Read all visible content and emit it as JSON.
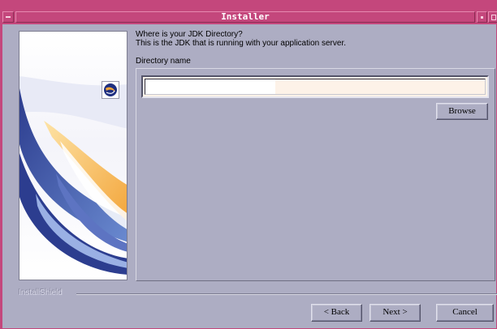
{
  "window": {
    "title": "Installer"
  },
  "header": {
    "line1": "Where is your JDK Directory?",
    "line2": "This is the JDK that is running with your application server."
  },
  "directory": {
    "label": "Directory name",
    "value": ""
  },
  "buttons": {
    "browse": "Browse",
    "back": "< Back",
    "next": "Next >",
    "cancel": "Cancel"
  },
  "footer": {
    "brand": "InstallShield"
  },
  "colors": {
    "titlebar": "#c4477c",
    "background": "#adadc3",
    "input_background": "#fdf2e8"
  },
  "icons": {
    "window_menu": "window-menu-icon",
    "minimize": "minimize-icon",
    "maximize": "maximize-icon",
    "logo": "installshield-logo-icon"
  }
}
